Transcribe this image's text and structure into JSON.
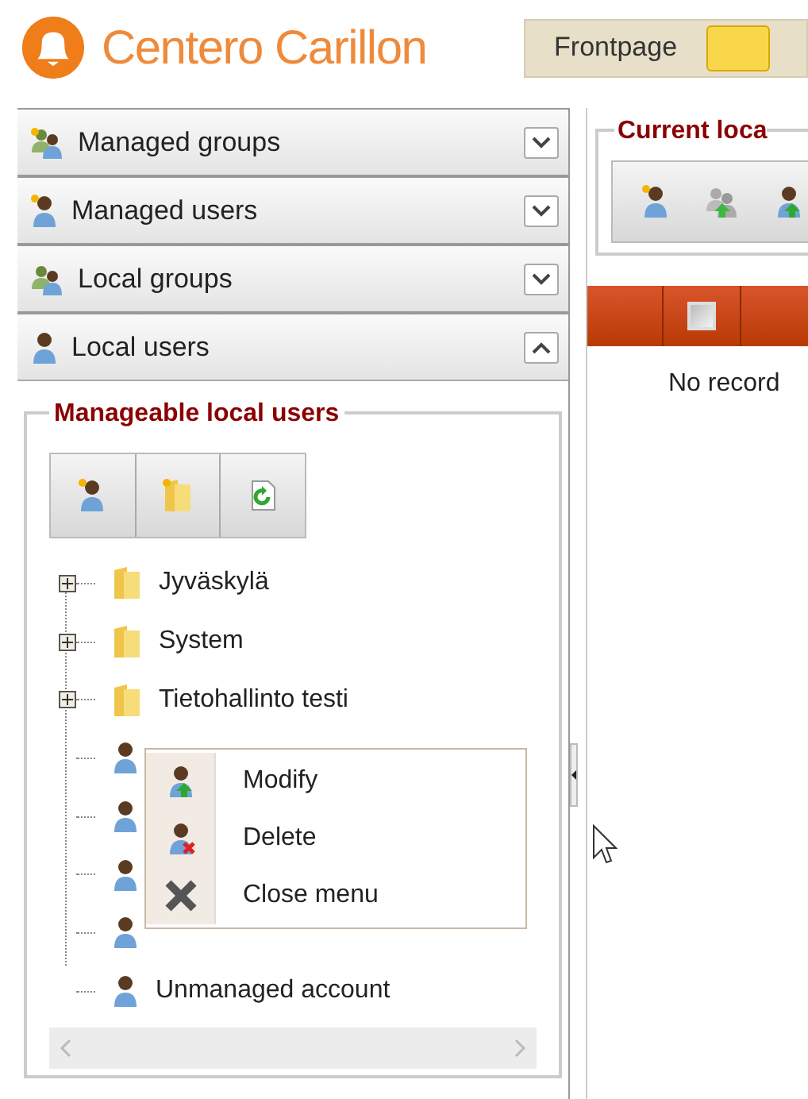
{
  "app": {
    "title": "Centero Carillon"
  },
  "nav_tabs": [
    {
      "label": "Frontpage",
      "selected": false
    },
    {
      "selected": true
    }
  ],
  "accordion": [
    {
      "label": "Managed groups",
      "expanded": false
    },
    {
      "label": "Managed users",
      "expanded": false
    },
    {
      "label": "Local groups",
      "expanded": false
    },
    {
      "label": "Local users",
      "expanded": true
    }
  ],
  "manageable_panel": {
    "title": "Manageable local users",
    "tree": [
      {
        "kind": "folder",
        "label": "Jyväskylä",
        "expanded": false
      },
      {
        "kind": "folder",
        "label": "System",
        "expanded": false
      },
      {
        "kind": "folder",
        "label": "Tietohallinto testi",
        "expanded": false
      },
      {
        "kind": "user"
      },
      {
        "kind": "user"
      },
      {
        "kind": "user"
      },
      {
        "kind": "user"
      },
      {
        "kind": "user",
        "label": "Unmanaged account"
      }
    ]
  },
  "context_menu": [
    {
      "label": "Modify"
    },
    {
      "label": "Delete"
    },
    {
      "label": "Close menu"
    }
  ],
  "current_panel": {
    "title": "Current loca"
  },
  "table": {
    "select_all_checked": false,
    "empty_message": "No record"
  }
}
